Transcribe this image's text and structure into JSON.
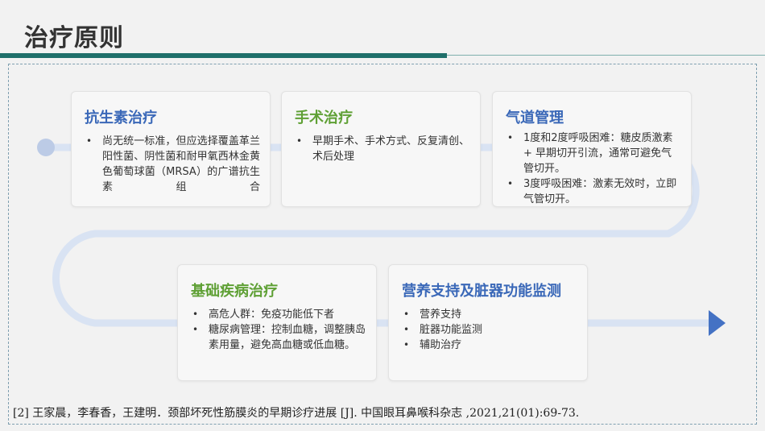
{
  "page": {
    "title": "治疗原则"
  },
  "cards": {
    "antibiotic": {
      "title": "抗生素治疗",
      "items": [
        "尚无统一标准，但应选择覆盖革兰阳性菌、阴性菌和耐甲氧西林金黄色葡萄球菌（MRSA）的广谱抗生素组合"
      ]
    },
    "surgery": {
      "title": "手术治疗",
      "items": [
        "早期手术、手术方式、反复清创、术后处理"
      ]
    },
    "airway": {
      "title": "气道管理",
      "items": [
        "1度和2度呼吸困难：糖皮质激素 + 早期切开引流，通常可避免气管切开。",
        "3度呼吸困难：激素无效时，立即气管切开。"
      ]
    },
    "basic": {
      "title": "基础疾病治疗",
      "items": [
        "高危人群：免疫功能低下者",
        "糖尿病管理：控制血糖，调整胰岛素用量，避免高血糖或低血糖。"
      ]
    },
    "nutrition": {
      "title": "营养支持及脏器功能监测",
      "items": [
        "营养支持",
        "脏器功能监测",
        "辅助治疗"
      ]
    }
  },
  "reference": "[2] 王家晨，李春香，王建明．颈部坏死性筋膜炎的早期诊疗进展 [J]. 中国眼耳鼻喉科杂志 ,2021,21(01):69-73.",
  "colors": {
    "accent_dark": "#1f6f6a",
    "path": "#d9e3f3",
    "arrow": "#4472c4",
    "title_blue": "#3a68b8",
    "title_green": "#5fa035"
  }
}
